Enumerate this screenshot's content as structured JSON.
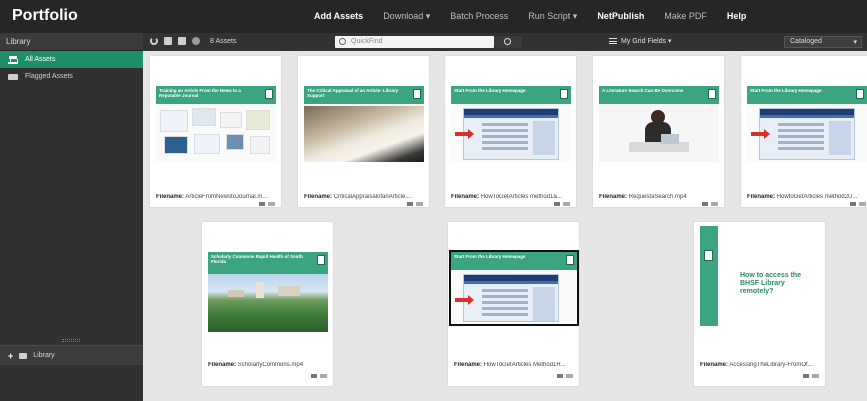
{
  "app": {
    "title": "Portfolio"
  },
  "topmenu": {
    "items": [
      {
        "label": "Add Assets",
        "strong": true
      },
      {
        "label": "Download ▾",
        "strong": false
      },
      {
        "label": "Batch Process",
        "strong": false
      },
      {
        "label": "Run Script ▾",
        "strong": false
      },
      {
        "label": "NetPublish",
        "strong": true
      },
      {
        "label": "Make PDF",
        "strong": false
      },
      {
        "label": "Help",
        "strong": true
      }
    ]
  },
  "sidebar": {
    "header": "Library",
    "items": [
      {
        "label": "All Assets",
        "icon": "building-icon",
        "active": true
      },
      {
        "label": "Flagged Assets",
        "icon": "flag-icon",
        "active": false
      }
    ],
    "bottom_label": "Library"
  },
  "toolbar": {
    "asset_count": "8 Assets",
    "search_placeholder": "QuickFind",
    "fields_label": "My Grid Fields ▾",
    "status_label": "Cataloged"
  },
  "assets": [
    {
      "title": "Training an Article From the News to a Reputable Journal",
      "filename_label": "Filename:",
      "filename": "ArticleFromNewstoJournal.m...",
      "kind": "collage"
    },
    {
      "title": "The Critical Appraisal of an Article: Library Support",
      "filename_label": "Filename:",
      "filename": "CriticalAppraisalofanArticle....",
      "kind": "book"
    },
    {
      "title": "Start From the Library Homepage",
      "filename_label": "Filename:",
      "filename": "HowToGetArticles method1&...",
      "kind": "web"
    },
    {
      "title": "A Literature Search Can Be Overcome",
      "filename_label": "Filename:",
      "filename": "RequestaSearch.mp4",
      "kind": "person"
    },
    {
      "title": "Start From the Library Homepage",
      "filename_label": "Filename:",
      "filename": "HowtoGetArticles method2U...",
      "kind": "web"
    },
    {
      "title": "Scholarly Commons Rapid Health of South Florida",
      "filename_label": "Filename:",
      "filename": "ScholarlyCommons.mp4",
      "kind": "campus"
    },
    {
      "title": "Start From the Library Homepage",
      "filename_label": "Filename:",
      "filename": "HowToGetArticles Method1R...",
      "kind": "web"
    },
    {
      "title": "How to access the BHSF Library remotely?",
      "filename_label": "Filename:",
      "filename": "AccessingTheLibrary-FromOf...",
      "kind": "text"
    }
  ]
}
